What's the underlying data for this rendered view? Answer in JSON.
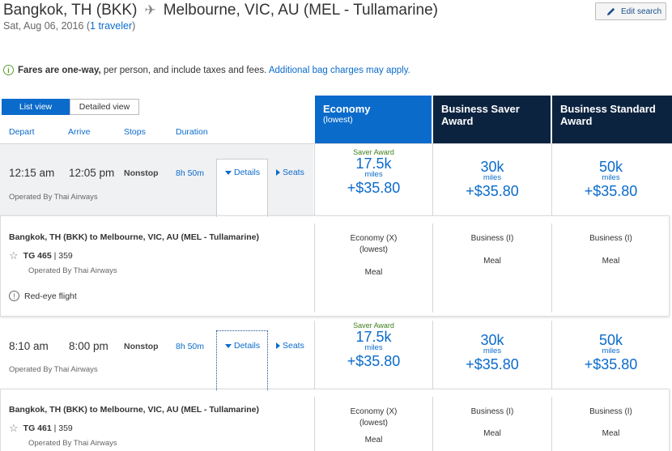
{
  "header": {
    "origin": "Bangkok, TH (BKK)",
    "destination": "Melbourne, VIC, AU (MEL - Tullamarine)",
    "date": "Sat, Aug 06, 2016",
    "travelers": "1 traveler",
    "edit_label": "Edit search"
  },
  "notice": {
    "bold": "Fares are one-way,",
    "rest": " per person, and include taxes and fees.",
    "link": "Additional bag charges may apply."
  },
  "view_toggle": {
    "list": "List view",
    "detailed": "Detailed view"
  },
  "columns": {
    "depart": "Depart",
    "arrive": "Arrive",
    "stops": "Stops",
    "duration": "Duration"
  },
  "fare_columns": [
    {
      "name": "Economy",
      "sub": "(lowest)"
    },
    {
      "name": "Business Saver Award",
      "sub": ""
    },
    {
      "name": "Business Standard Award",
      "sub": ""
    }
  ],
  "flights": [
    {
      "depart": "12:15 am",
      "arrive": "12:05 pm",
      "stops": "Nonstop",
      "duration": "8h 50m",
      "operated": "Operated By Thai Airways",
      "details_label": "Details",
      "seats_label": "Seats",
      "prices": [
        {
          "saver": "Saver Award",
          "miles": "17.5k",
          "miles_label": "miles",
          "tax": "+$35.80"
        },
        {
          "saver": "",
          "miles": "30k",
          "miles_label": "miles",
          "tax": "+$35.80"
        },
        {
          "saver": "",
          "miles": "50k",
          "miles_label": "miles",
          "tax": "+$35.80"
        }
      ],
      "detail": {
        "route": "Bangkok, TH (BKK) to Melbourne, VIC, AU (MEL - Tullamarine)",
        "flight": "TG 465",
        "aircraft": "359",
        "operated": "Operated By Thai Airways",
        "note": "Red-eye flight",
        "cabins": [
          {
            "class": "Economy (X)",
            "sub": "(lowest)",
            "meal": "Meal"
          },
          {
            "class": "Business (I)",
            "sub": "",
            "meal": "Meal"
          },
          {
            "class": "Business (I)",
            "sub": "",
            "meal": "Meal"
          }
        ]
      }
    },
    {
      "depart": "8:10 am",
      "arrive": "8:00 pm",
      "stops": "Nonstop",
      "duration": "8h 50m",
      "operated": "Operated By Thai Airways",
      "details_label": "Details",
      "seats_label": "Seats",
      "prices": [
        {
          "saver": "Saver Award",
          "miles": "17.5k",
          "miles_label": "miles",
          "tax": "+$35.80"
        },
        {
          "saver": "",
          "miles": "30k",
          "miles_label": "miles",
          "tax": "+$35.80"
        },
        {
          "saver": "",
          "miles": "50k",
          "miles_label": "miles",
          "tax": "+$35.80"
        }
      ],
      "detail": {
        "route": "Bangkok, TH (BKK) to Melbourne, VIC, AU (MEL - Tullamarine)",
        "flight": "TG 461",
        "aircraft": "359",
        "operated": "Operated By Thai Airways",
        "cabins": [
          {
            "class": "Economy (X)",
            "sub": "(lowest)",
            "meal": "Meal"
          },
          {
            "class": "Business (I)",
            "sub": "",
            "meal": "Meal"
          },
          {
            "class": "Business (I)",
            "sub": "",
            "meal": "Meal"
          }
        ]
      }
    }
  ],
  "colors": {
    "primary": "#0b6bcb",
    "navy": "#0c2340",
    "saver_green": "#3f7f1c"
  }
}
